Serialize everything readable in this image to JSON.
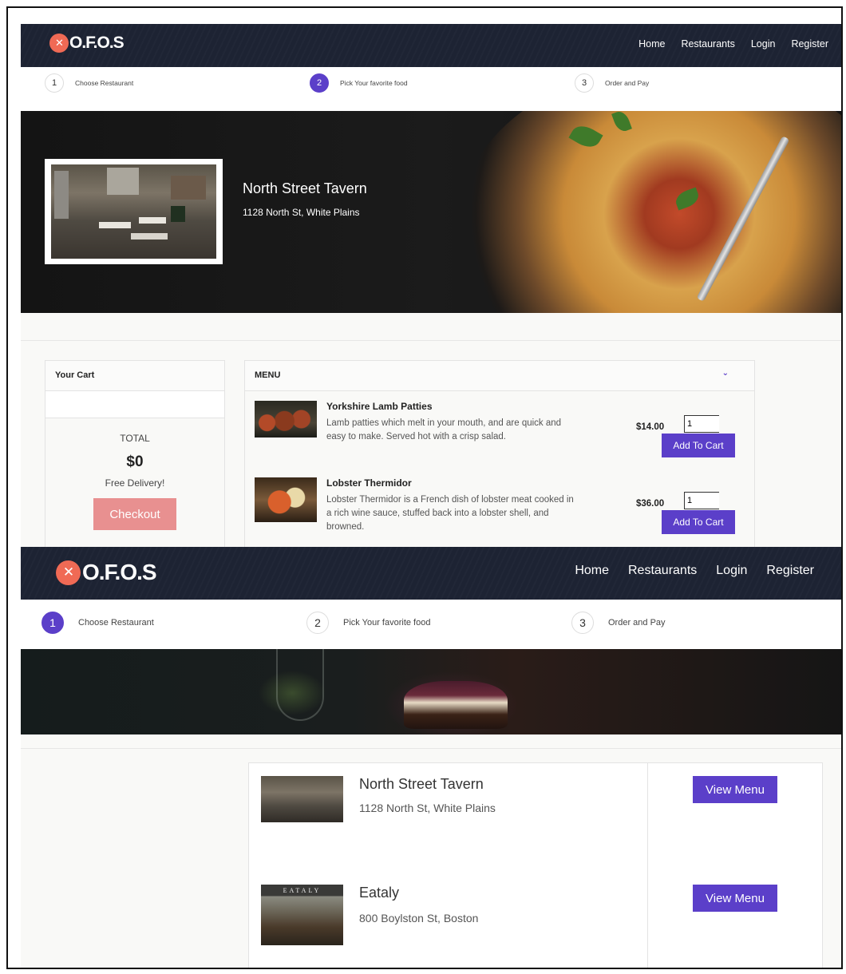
{
  "top": {
    "brand": "O.F.O.S",
    "nav": [
      "Home",
      "Restaurants",
      "Login",
      "Register"
    ],
    "steps": [
      {
        "num": "1",
        "label": "Choose Restaurant"
      },
      {
        "num": "2",
        "label": "Pick Your favorite food"
      },
      {
        "num": "3",
        "label": "Order and Pay"
      }
    ],
    "active_step": 2,
    "restaurant": {
      "name": "North Street Tavern",
      "address": "1128 North St, White Plains"
    },
    "cart": {
      "title": "Your Cart",
      "total_label": "TOTAL",
      "total": "$0",
      "delivery": "Free Delivery!",
      "checkout": "Checkout"
    },
    "menu": {
      "title": "MENU",
      "items": [
        {
          "name": "Yorkshire Lamb Patties",
          "desc": "Lamb patties which melt in your mouth, and are quick and easy to make. Served hot with a crisp salad.",
          "price": "$14.00",
          "qty": "1",
          "button": "Add To Cart"
        },
        {
          "name": "Lobster Thermidor",
          "desc": "Lobster Thermidor is a French dish of lobster meat cooked in a rich wine sauce, stuffed back into a lobster shell, and browned.",
          "price": "$36.00",
          "qty": "1",
          "button": "Add To Cart"
        }
      ]
    }
  },
  "bottom": {
    "brand": "O.F.O.S",
    "nav": [
      "Home",
      "Restaurants",
      "Login",
      "Register"
    ],
    "steps": [
      {
        "num": "1",
        "label": "Choose Restaurant"
      },
      {
        "num": "2",
        "label": "Pick Your favorite food"
      },
      {
        "num": "3",
        "label": "Order and Pay"
      }
    ],
    "active_step": 1,
    "restaurants": [
      {
        "name": "North Street Tavern",
        "address": "1128 North St, White Plains",
        "button": "View Menu"
      },
      {
        "name": "Eataly",
        "address": "800 Boylston St, Boston",
        "button": "View Menu",
        "sign": "EATALY"
      }
    ]
  },
  "colors": {
    "accent": "#5b3fc9",
    "logo": "#f06a55",
    "navbar": "#1d2333",
    "checkout": "#e89090"
  }
}
